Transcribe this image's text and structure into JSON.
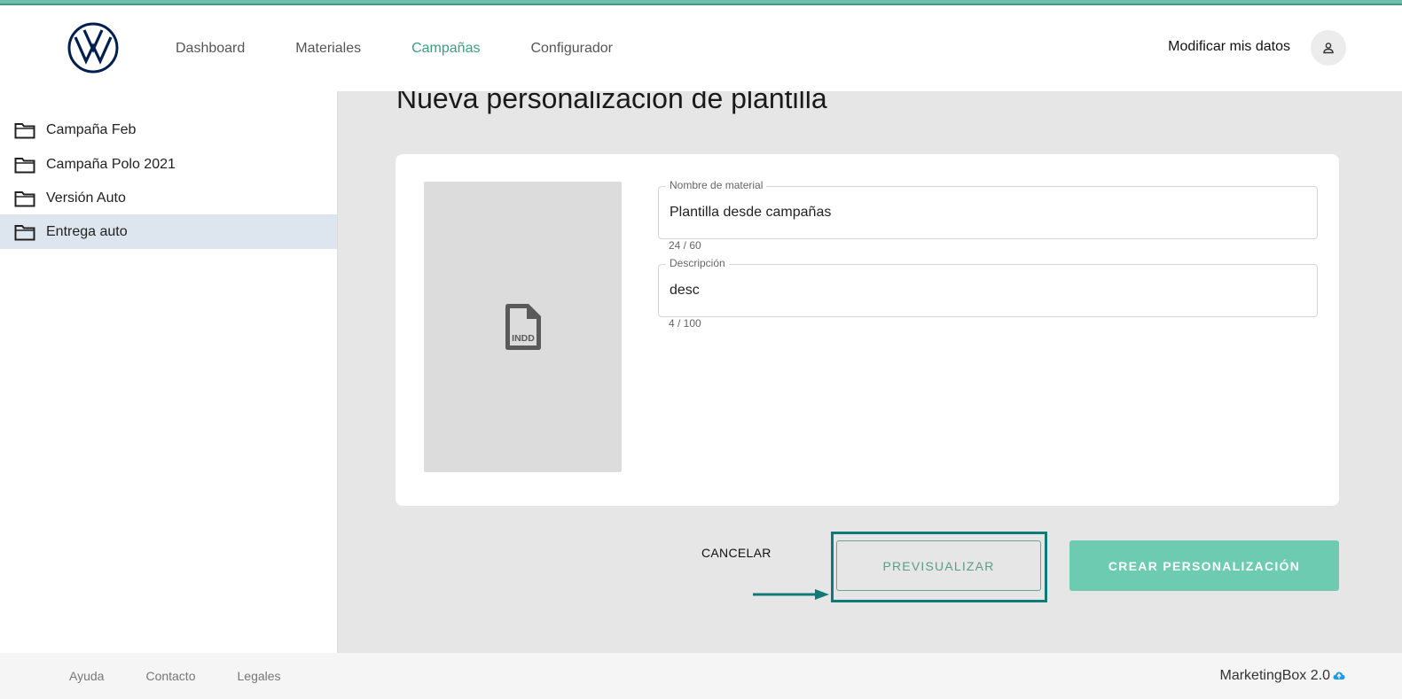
{
  "header": {
    "nav": [
      {
        "label": "Dashboard",
        "active": false
      },
      {
        "label": "Materiales",
        "active": false
      },
      {
        "label": "Campañas",
        "active": true
      },
      {
        "label": "Configurador",
        "active": false
      }
    ],
    "user_link": "Modificar mis datos"
  },
  "sidebar": {
    "items": [
      {
        "label": "Campaña Feb",
        "selected": false
      },
      {
        "label": "Campaña Polo 2021",
        "selected": false
      },
      {
        "label": "Versión Auto",
        "selected": false
      },
      {
        "label": "Entrega auto",
        "selected": true
      }
    ]
  },
  "main": {
    "title": "Nueva personalización de plantilla",
    "file_type": "INDD",
    "fields": {
      "name": {
        "label": "Nombre de material",
        "value": "Plantilla desde campañas",
        "counter": "24 / 60"
      },
      "description": {
        "label": "Descripción",
        "value": "desc",
        "counter": "4 / 100"
      }
    },
    "actions": {
      "cancel": "CANCELAR",
      "preview": "PREVISUALIZAR",
      "create": "CREAR PERSONALIZACIÓN"
    }
  },
  "footer": {
    "links": [
      "Ayuda",
      "Contacto",
      "Legales"
    ],
    "brand": "MarketingBox 2.0"
  },
  "colors": {
    "accent": "#6dcbb1",
    "nav_active": "#3f9b81",
    "highlight": "#0f7a78"
  }
}
